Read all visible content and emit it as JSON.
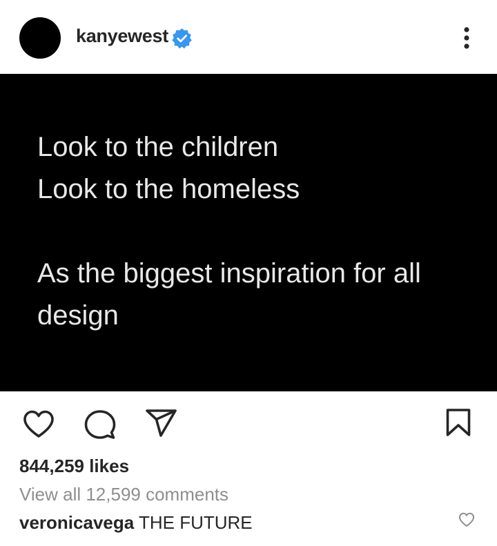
{
  "header": {
    "username": "kanyewest",
    "verified": true,
    "verified_color": "#3897f0",
    "icons": [
      "avatar",
      "verified-badge-icon",
      "more-options-icon"
    ]
  },
  "post": {
    "background": "#000000",
    "text_color": "#e8e8e8",
    "lines": [
      "Look to the children",
      "Look to the homeless",
      "As the biggest inspiration for all",
      "design"
    ]
  },
  "actions": {
    "icons": [
      "heart-icon",
      "comment-icon",
      "share-icon",
      "bookmark-icon"
    ]
  },
  "likes": {
    "text": "844,259 likes"
  },
  "comments": {
    "view_all": "View all 12,599 comments",
    "items": [
      {
        "user": "veronicavega",
        "text": "THE FUTURE"
      }
    ]
  }
}
